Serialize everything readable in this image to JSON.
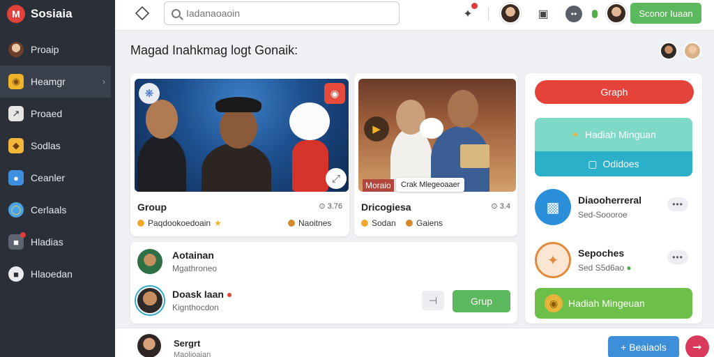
{
  "app": {
    "name": "Sosiaia",
    "logo_letter": "M"
  },
  "sidebar": {
    "items": [
      {
        "label": "Proaip",
        "icon": "avatar"
      },
      {
        "label": "Heamgr",
        "icon": "bee-icon",
        "active": true
      },
      {
        "label": "Proaed",
        "icon": "chart-icon"
      },
      {
        "label": "Sodlas",
        "icon": "tag-icon"
      },
      {
        "label": "Ceanler",
        "icon": "people-icon"
      },
      {
        "label": "Cerlaals",
        "icon": "globe-icon"
      },
      {
        "label": "Hladias",
        "icon": "notification-icon"
      },
      {
        "label": "Hlaoedan",
        "icon": "chat-icon"
      }
    ]
  },
  "header": {
    "search_placeholder": "Iadanaoaoin",
    "cta_label": "Sconor Iuaan"
  },
  "main": {
    "title": "Magad Inahkmag logt Gonaik:",
    "cards": [
      {
        "title": "Group",
        "meta": "⊙ 3.76",
        "left_tag": "Paqdookoedoain",
        "right_tag": "Naoitnes"
      },
      {
        "title": "Dricogiesa",
        "meta": "⊙ 3.4",
        "left_tag": "Sodan",
        "right_tag": "Gaiens",
        "overlay_label": "Moraio",
        "overlay_tag": "Crak Mlegeoaaer"
      }
    ],
    "list": [
      {
        "name": "Aotainan",
        "sub": "Mgathroneo"
      },
      {
        "name": "Doask Iaan",
        "sub": "Kignthocdon",
        "button": "Grup"
      }
    ]
  },
  "right_panel": {
    "top_button": "Graph",
    "block1": "Hadiah Minguan",
    "block2": "Odidoes",
    "row1": {
      "name": "Diaooherreral",
      "sub": "Sed-Soooroe"
    },
    "row2": {
      "name": "Sepoches",
      "sub": "Sed S5d6ao"
    },
    "bottom_button": "Hadiah Mingeuan"
  },
  "bottom": {
    "name": "Sergrt",
    "sub": "Maolioaian",
    "button": "Beaiaols"
  },
  "colors": {
    "sidebar_bg": "#2a2f38",
    "accent_green": "#5cb85c",
    "accent_red": "#e5423a",
    "accent_teal": "#2bb0c8",
    "accent_blue": "#3c8fd8"
  }
}
